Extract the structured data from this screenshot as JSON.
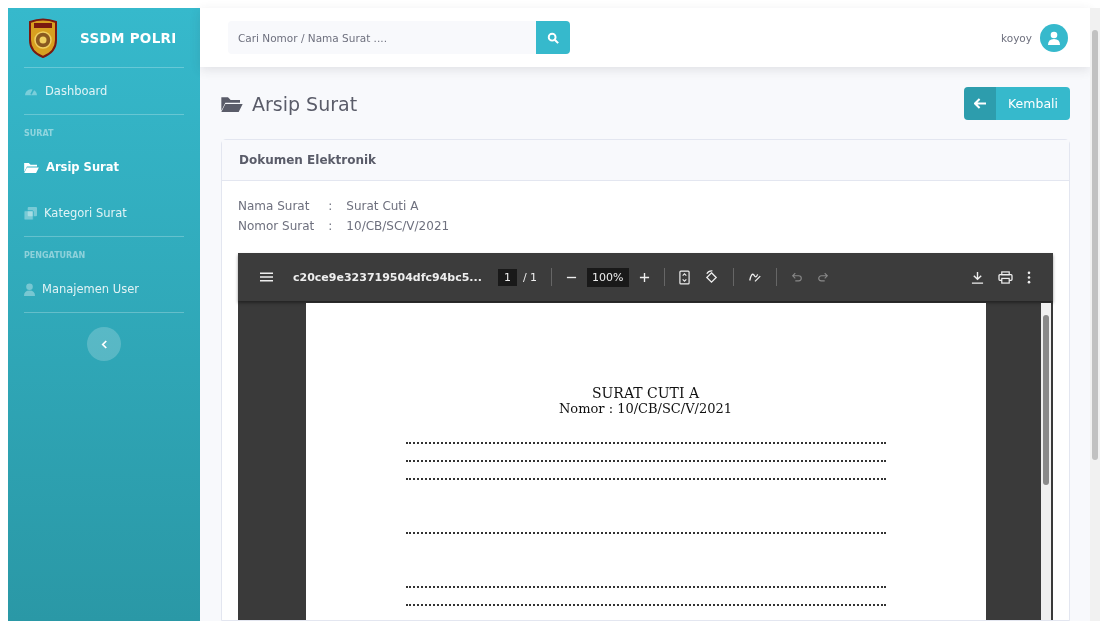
{
  "sidebar": {
    "brand": "SSDM POLRI",
    "items": [
      {
        "kind": "link",
        "label": "Dashboard",
        "selected": false
      },
      {
        "kind": "heading",
        "label": "SURAT"
      },
      {
        "kind": "link",
        "label": "Arsip Surat",
        "selected": true
      },
      {
        "kind": "link",
        "label": "Kategori Surat",
        "selected": false
      },
      {
        "kind": "heading",
        "label": "PENGATURAN"
      },
      {
        "kind": "link",
        "label": "Manajemen User",
        "selected": false
      }
    ]
  },
  "topbar": {
    "search": {
      "placeholder": "Cari Nomor / Nama Surat ...."
    },
    "user": "koyoy"
  },
  "page": {
    "title": "Arsip Surat",
    "back_button": "Kembali"
  },
  "card": {
    "title": "Dokumen Elektronik",
    "fields": [
      {
        "label": "Nama Surat",
        "separator": ":",
        "value": "Surat Cuti A"
      },
      {
        "label": "Nomor Surat",
        "separator": ":",
        "value": "10/CB/SC/V/2021"
      }
    ]
  },
  "pdf_viewer": {
    "filename": "c20ce9e323719504dfc94bc5...",
    "page": "1",
    "page_count": "/ 1",
    "zoom": "100%",
    "document": {
      "title": "SURAT CUTI A",
      "number": "Nomor : 10/CB/SC/V/2021"
    }
  }
}
